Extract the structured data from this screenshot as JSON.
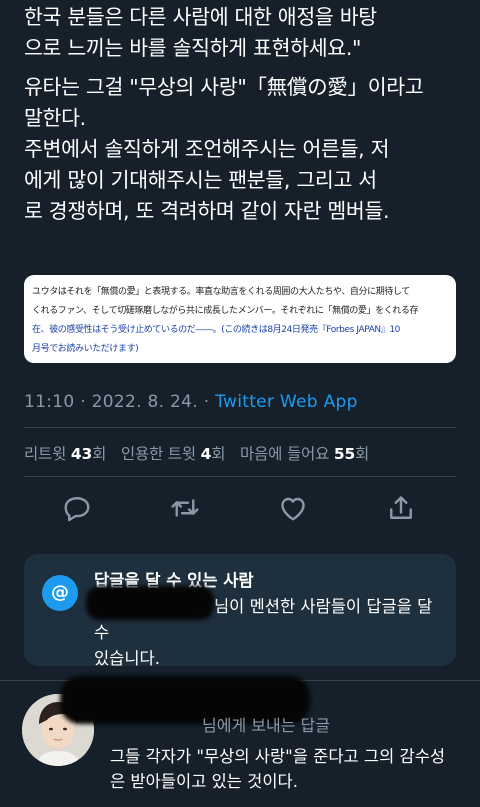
{
  "tweet": {
    "text_lines_1": [
      "한국 분들은 다른 사람에 대한 애정을 바탕",
      "으로 느끼는 바를 솔직하게 표현하세요.\""
    ],
    "text_lines_2": [
      "유타는 그걸 \"무상의 사랑\"「無償の愛」이라고",
      "말한다.",
      "주변에서 솔직하게 조언해주시는 어른들, 저",
      "에게 많이 기대해주시는 팬분들, 그리고 서",
      "로 경쟁하며, 또 격려하며 같이 자란 멤버들."
    ],
    "embed_lines": [
      "ユウタはそれを「無償の愛」と表現する。率直な助言をくれる周囲の大人たちや、自分に期待して",
      "くれるファン、そして切磋琢磨しながら共に成長したメンバー。それぞれに「無償の愛」をくれる存",
      "在、彼の感受性はそう受け止めているのだ――。(この続きは8月24日発売『Forbes JAPAN』10",
      "月号でお読みいただけます)"
    ],
    "time": "11:10",
    "date": "2022. 8. 24.",
    "source": "Twitter Web App"
  },
  "stats": {
    "retweets_label": "리트윗",
    "retweets_count": "43",
    "retweets_unit": "회",
    "quotes_label": "인용한 트윗",
    "quotes_count": "4",
    "quotes_unit": "회",
    "likes_label": "마음에 들어요",
    "likes_count": "55",
    "likes_unit": "회"
  },
  "actions": {
    "icons": [
      "reply-icon",
      "retweet-icon",
      "like-icon",
      "share-icon"
    ]
  },
  "reply_restriction": {
    "icon": "@",
    "title": "답글을 달 수 있는 사람",
    "desc_part": "님이 멘션한 사람들이 답글을 달 수",
    "desc_line2": "있습니다."
  },
  "reply_tweet": {
    "reply_to_suffix": "님에게 보내는 답글",
    "text_lines": [
      "그들 각자가 \"무상의 사랑\"을 준다고 그의 감수성",
      "은 받아들이고 있는 것이다."
    ]
  },
  "colors": {
    "background": "#15202b",
    "accent": "#1d9bf0",
    "muted": "#8b98a5",
    "card": "#1e2f3e"
  }
}
